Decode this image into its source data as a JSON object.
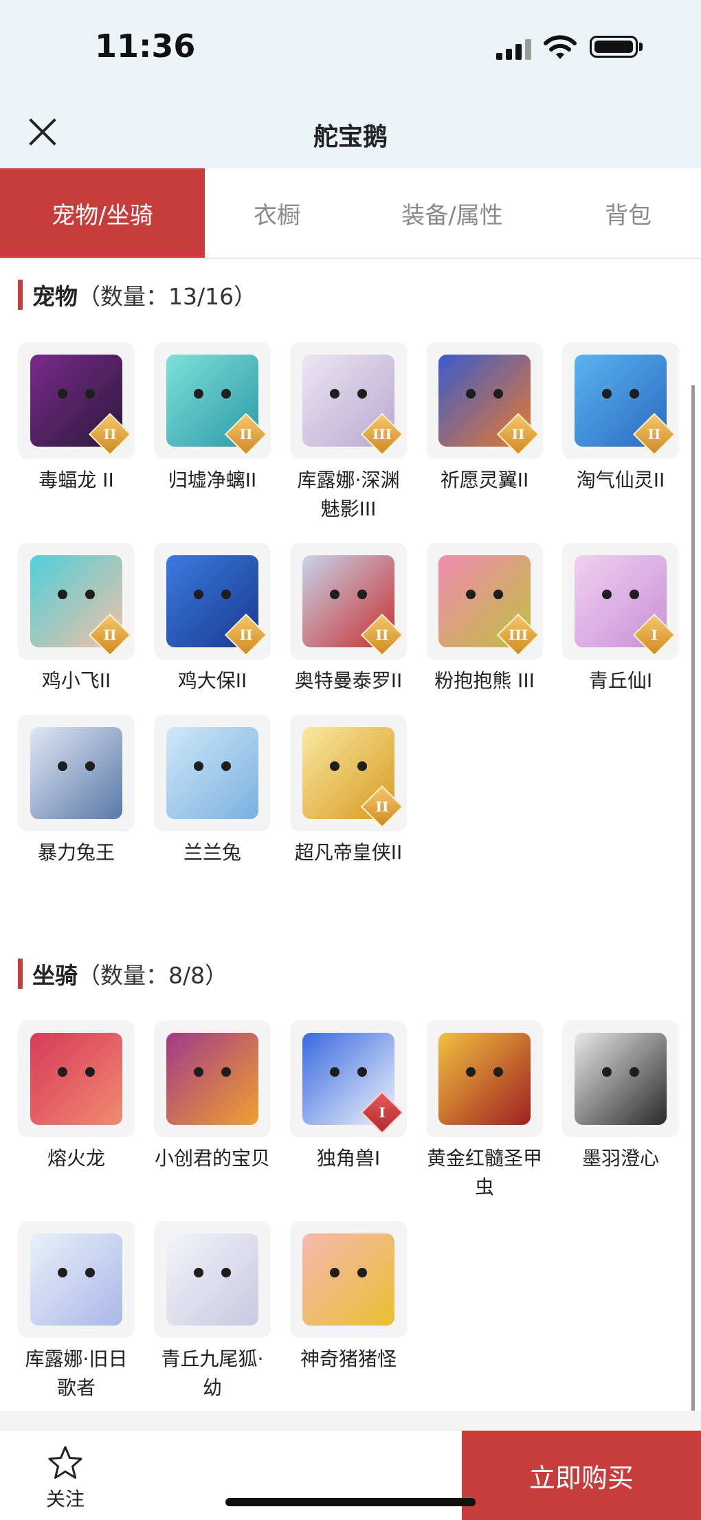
{
  "status_bar": {
    "time": "11:36"
  },
  "nav": {
    "title": "舵宝鹅"
  },
  "tabs": [
    {
      "label": "宠物/坐骑",
      "active": true
    },
    {
      "label": "衣橱",
      "active": false
    },
    {
      "label": "装备/属性",
      "active": false
    },
    {
      "label": "背包",
      "active": false
    }
  ],
  "pets": {
    "title": "宠物",
    "count": "（数量：13/16）",
    "items": [
      {
        "name": "毒蝠龙 II",
        "badge": "II"
      },
      {
        "name": "归墟净螭II",
        "badge": "II"
      },
      {
        "name": "库露娜·深渊魅影III",
        "badge": "III"
      },
      {
        "name": "祈愿灵翼II",
        "badge": "II"
      },
      {
        "name": "淘气仙灵II",
        "badge": "II"
      },
      {
        "name": "鸡小飞II",
        "badge": "II"
      },
      {
        "name": "鸡大保II",
        "badge": "II"
      },
      {
        "name": "奥特曼泰罗II",
        "badge": "II"
      },
      {
        "name": "粉抱抱熊 III",
        "badge": "III"
      },
      {
        "name": "青丘仙I",
        "badge": "I"
      },
      {
        "name": "暴力兔王",
        "badge": ""
      },
      {
        "name": "兰兰兔",
        "badge": ""
      },
      {
        "name": "超凡帝皇侠II",
        "badge": "II"
      }
    ]
  },
  "mounts": {
    "title": "坐骑",
    "count": "（数量：8/8）",
    "items": [
      {
        "name": "熔火龙",
        "badge": ""
      },
      {
        "name": "小创君的宝贝",
        "badge": ""
      },
      {
        "name": "独角兽I",
        "badge": "I"
      },
      {
        "name": "黄金红髓圣甲虫",
        "badge": ""
      },
      {
        "name": "墨羽澄心",
        "badge": ""
      },
      {
        "name": "库露娜·旧日歌者",
        "badge": ""
      },
      {
        "name": "青丘九尾狐·幼",
        "badge": ""
      },
      {
        "name": "神奇猪猪怪",
        "badge": ""
      }
    ]
  },
  "bottom": {
    "follow_label": "关注",
    "buy_label": "立即购买"
  },
  "colors": {
    "accent": "#c83c3c",
    "nav_bg": "#edf4f7",
    "card_bg": "#f4f4f4"
  }
}
